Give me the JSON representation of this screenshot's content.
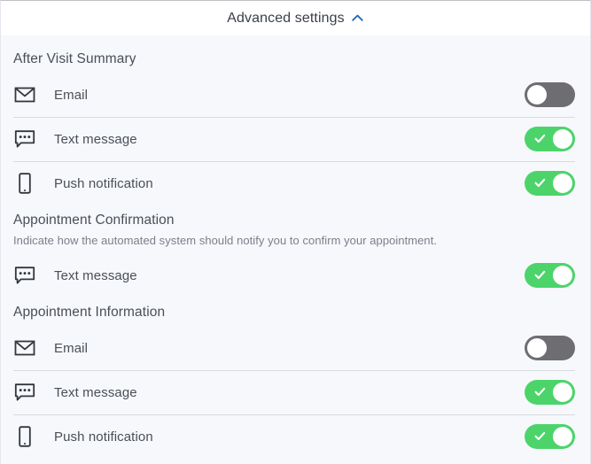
{
  "header": {
    "title": "Advanced settings",
    "chevron_icon": "chevron-up-icon",
    "chevron_color": "#2b6cb8",
    "expanded": true
  },
  "colors": {
    "page_background": "#f6f8fc",
    "header_background": "#ffffff",
    "toggle_on": "#4cd46b",
    "toggle_off": "#6e6e72",
    "divider": "#d9dade",
    "title_text": "#4a4f57",
    "description_text": "#7b7f88"
  },
  "sections": [
    {
      "title": "After Visit Summary",
      "description": "",
      "rows": [
        {
          "icon": "envelope-icon",
          "label": "Email",
          "enabled": false
        },
        {
          "icon": "speech-bubble-icon",
          "label": "Text message",
          "enabled": true
        },
        {
          "icon": "mobile-phone-icon",
          "label": "Push notification",
          "enabled": true
        }
      ]
    },
    {
      "title": "Appointment Confirmation",
      "description": "Indicate how the automated system should notify you to confirm your appointment.",
      "rows": [
        {
          "icon": "speech-bubble-icon",
          "label": "Text message",
          "enabled": true
        }
      ]
    },
    {
      "title": "Appointment Information",
      "description": "",
      "rows": [
        {
          "icon": "envelope-icon",
          "label": "Email",
          "enabled": false
        },
        {
          "icon": "speech-bubble-icon",
          "label": "Text message",
          "enabled": true
        },
        {
          "icon": "mobile-phone-icon",
          "label": "Push notification",
          "enabled": true
        }
      ]
    }
  ]
}
